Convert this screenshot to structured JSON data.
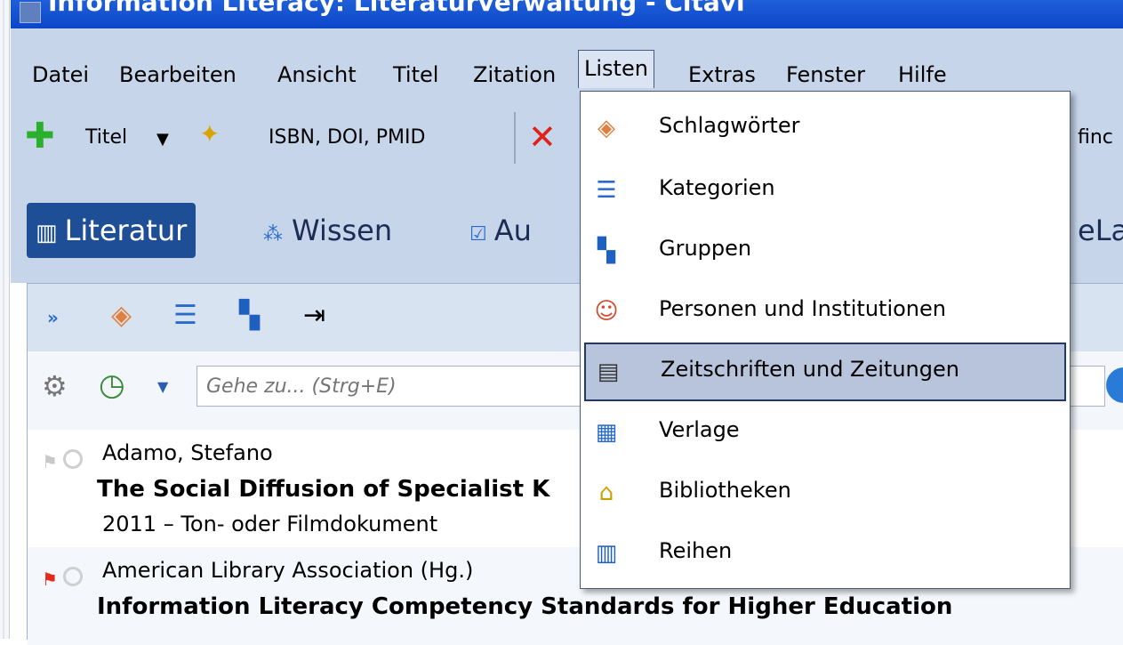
{
  "window": {
    "title": "Information Literacy: Literaturverwaltung - Citavi"
  },
  "menubar": {
    "items": [
      "Datei",
      "Bearbeiten",
      "Ansicht",
      "Titel",
      "Zitation",
      "Listen",
      "Extras",
      "Fenster",
      "Hilfe"
    ],
    "active": "Listen"
  },
  "toolbar": {
    "add_title": "Titel",
    "isbn": "ISBN, DOI, PMID",
    "find_partial": "finc"
  },
  "tabs": {
    "literatur": "Literatur",
    "wissen": "Wissen",
    "aufgaben_partial": "Au",
    "right_partial": "eLa"
  },
  "search": {
    "placeholder": "Gehe zu... (Strg+E)"
  },
  "entries": [
    {
      "author": "Adamo, Stefano",
      "title": "The Social Diffusion of Specialist K",
      "meta": "2011 – Ton- oder Filmdokument",
      "flag_color": "#c8c8c8"
    },
    {
      "author": "American Library Association (Hg.)",
      "title": "Information Literacy Competency Standards for Higher Education",
      "meta": "",
      "flag_color": "#e32b1c"
    }
  ],
  "listen_menu": {
    "items": [
      {
        "label": "Schlagwörter",
        "icon": "tag-icon"
      },
      {
        "label": "Kategorien",
        "icon": "category-tree-icon"
      },
      {
        "label": "Gruppen",
        "icon": "groups-icon"
      },
      {
        "label": "Personen und Institutionen",
        "icon": "person-card-icon"
      },
      {
        "label": "Zeitschriften und Zeitungen",
        "icon": "newspaper-icon"
      },
      {
        "label": "Verlage",
        "icon": "building-icon"
      },
      {
        "label": "Bibliotheken",
        "icon": "library-icon"
      },
      {
        "label": "Reihen",
        "icon": "series-books-icon"
      }
    ],
    "highlighted": "Zeitschriften und Zeitungen"
  }
}
